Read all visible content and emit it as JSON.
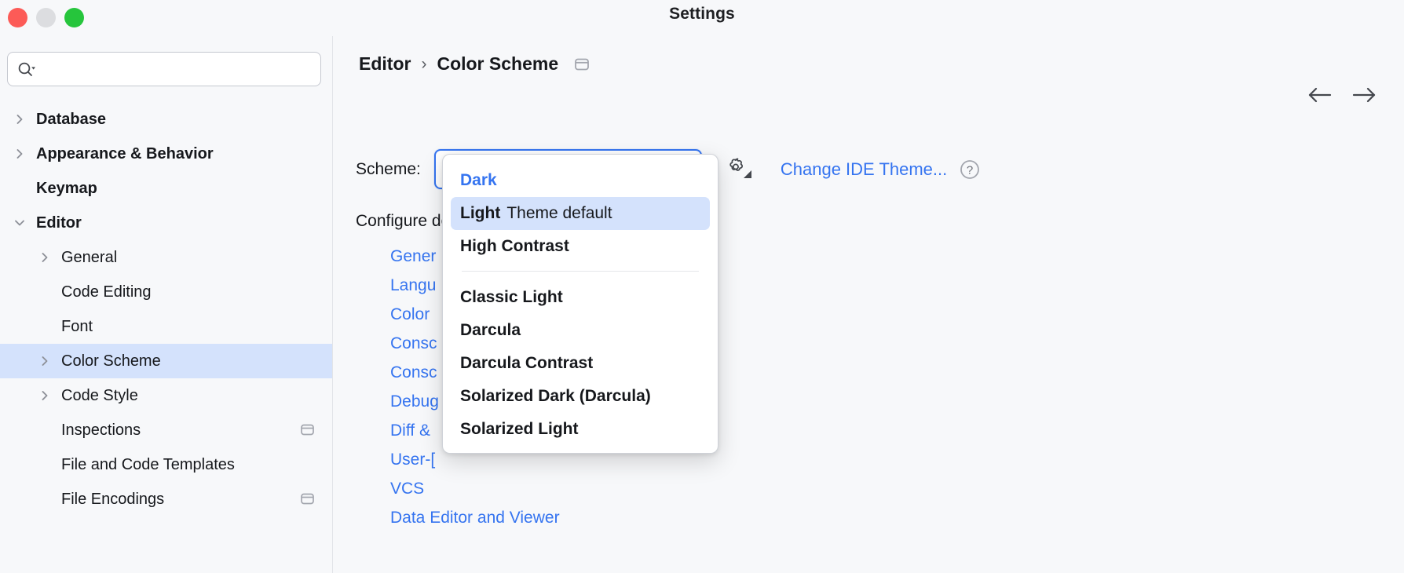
{
  "window": {
    "title": "Settings",
    "traffic_lights": [
      {
        "name": "close-button",
        "color": "#fc5b57"
      },
      {
        "name": "minimize-button",
        "color": "#dcdde0"
      },
      {
        "name": "maximize-button",
        "color": "#26c53c"
      }
    ]
  },
  "sidebar": {
    "search": {
      "value": "",
      "placeholder": ""
    },
    "items": [
      {
        "label": "Database",
        "indent": 0,
        "twisty": "collapsed",
        "bold": true,
        "selected": false,
        "icon": null
      },
      {
        "label": "Appearance & Behavior",
        "indent": 0,
        "twisty": "collapsed",
        "bold": true,
        "selected": false,
        "icon": null
      },
      {
        "label": "Keymap",
        "indent": 0,
        "twisty": "none",
        "bold": true,
        "selected": false,
        "icon": null
      },
      {
        "label": "Editor",
        "indent": 0,
        "twisty": "expanded",
        "bold": true,
        "selected": false,
        "icon": null
      },
      {
        "label": "General",
        "indent": 1,
        "twisty": "collapsed",
        "bold": false,
        "selected": false,
        "icon": null
      },
      {
        "label": "Code Editing",
        "indent": 1,
        "twisty": "none",
        "bold": false,
        "selected": false,
        "icon": null
      },
      {
        "label": "Font",
        "indent": 1,
        "twisty": "none",
        "bold": false,
        "selected": false,
        "icon": null
      },
      {
        "label": "Color Scheme",
        "indent": 1,
        "twisty": "collapsed",
        "bold": false,
        "selected": true,
        "icon": null
      },
      {
        "label": "Code Style",
        "indent": 1,
        "twisty": "collapsed",
        "bold": false,
        "selected": false,
        "icon": null
      },
      {
        "label": "Inspections",
        "indent": 1,
        "twisty": "none",
        "bold": false,
        "selected": false,
        "icon": "panel-icon"
      },
      {
        "label": "File and Code Templates",
        "indent": 1,
        "twisty": "none",
        "bold": false,
        "selected": false,
        "icon": null
      },
      {
        "label": "File Encodings",
        "indent": 1,
        "twisty": "none",
        "bold": false,
        "selected": false,
        "icon": "panel-icon"
      }
    ]
  },
  "main": {
    "breadcrumb": {
      "parent": "Editor",
      "separator": "›",
      "current": "Color Scheme",
      "icon": "panel-icon"
    },
    "nav": {
      "back_icon": "arrow-left-icon",
      "forward_icon": "arrow-right-icon"
    },
    "scheme": {
      "label": "Scheme:",
      "value_bold": "Light",
      "value_dim": "Theme default",
      "chevron_icon": "chevron-down-icon",
      "gear_icon": "gear-icon",
      "change_theme_link": "Change IDE Theme...",
      "help_icon": "help-circle-icon"
    },
    "configure_text": "Configure                                      de and console output:",
    "links": [
      "Gener",
      "Langu",
      "Color ",
      "Consc",
      "Consc",
      "Debug",
      "Diff & ",
      "User-[",
      "VCS",
      "Data Editor and Viewer"
    ]
  },
  "popup": {
    "items": [
      {
        "label": "Dark",
        "sub": "",
        "state": "active"
      },
      {
        "label": "Light",
        "sub": "Theme default",
        "state": "highlight"
      },
      {
        "label": "High Contrast",
        "sub": "",
        "state": "normal"
      },
      {
        "separator": true
      },
      {
        "label": "Classic Light",
        "sub": "",
        "state": "normal"
      },
      {
        "label": "Darcula",
        "sub": "",
        "state": "normal"
      },
      {
        "label": "Darcula Contrast",
        "sub": "",
        "state": "normal"
      },
      {
        "label": "Solarized Dark (Darcula)",
        "sub": "",
        "state": "normal"
      },
      {
        "label": "Solarized Light",
        "sub": "",
        "state": "normal"
      }
    ]
  },
  "colors": {
    "accent_blue": "#3574f0",
    "selection_blue": "#d4e2fc",
    "background": "#f7f8fa",
    "text": "#16181c",
    "dim_text": "#83868d"
  }
}
